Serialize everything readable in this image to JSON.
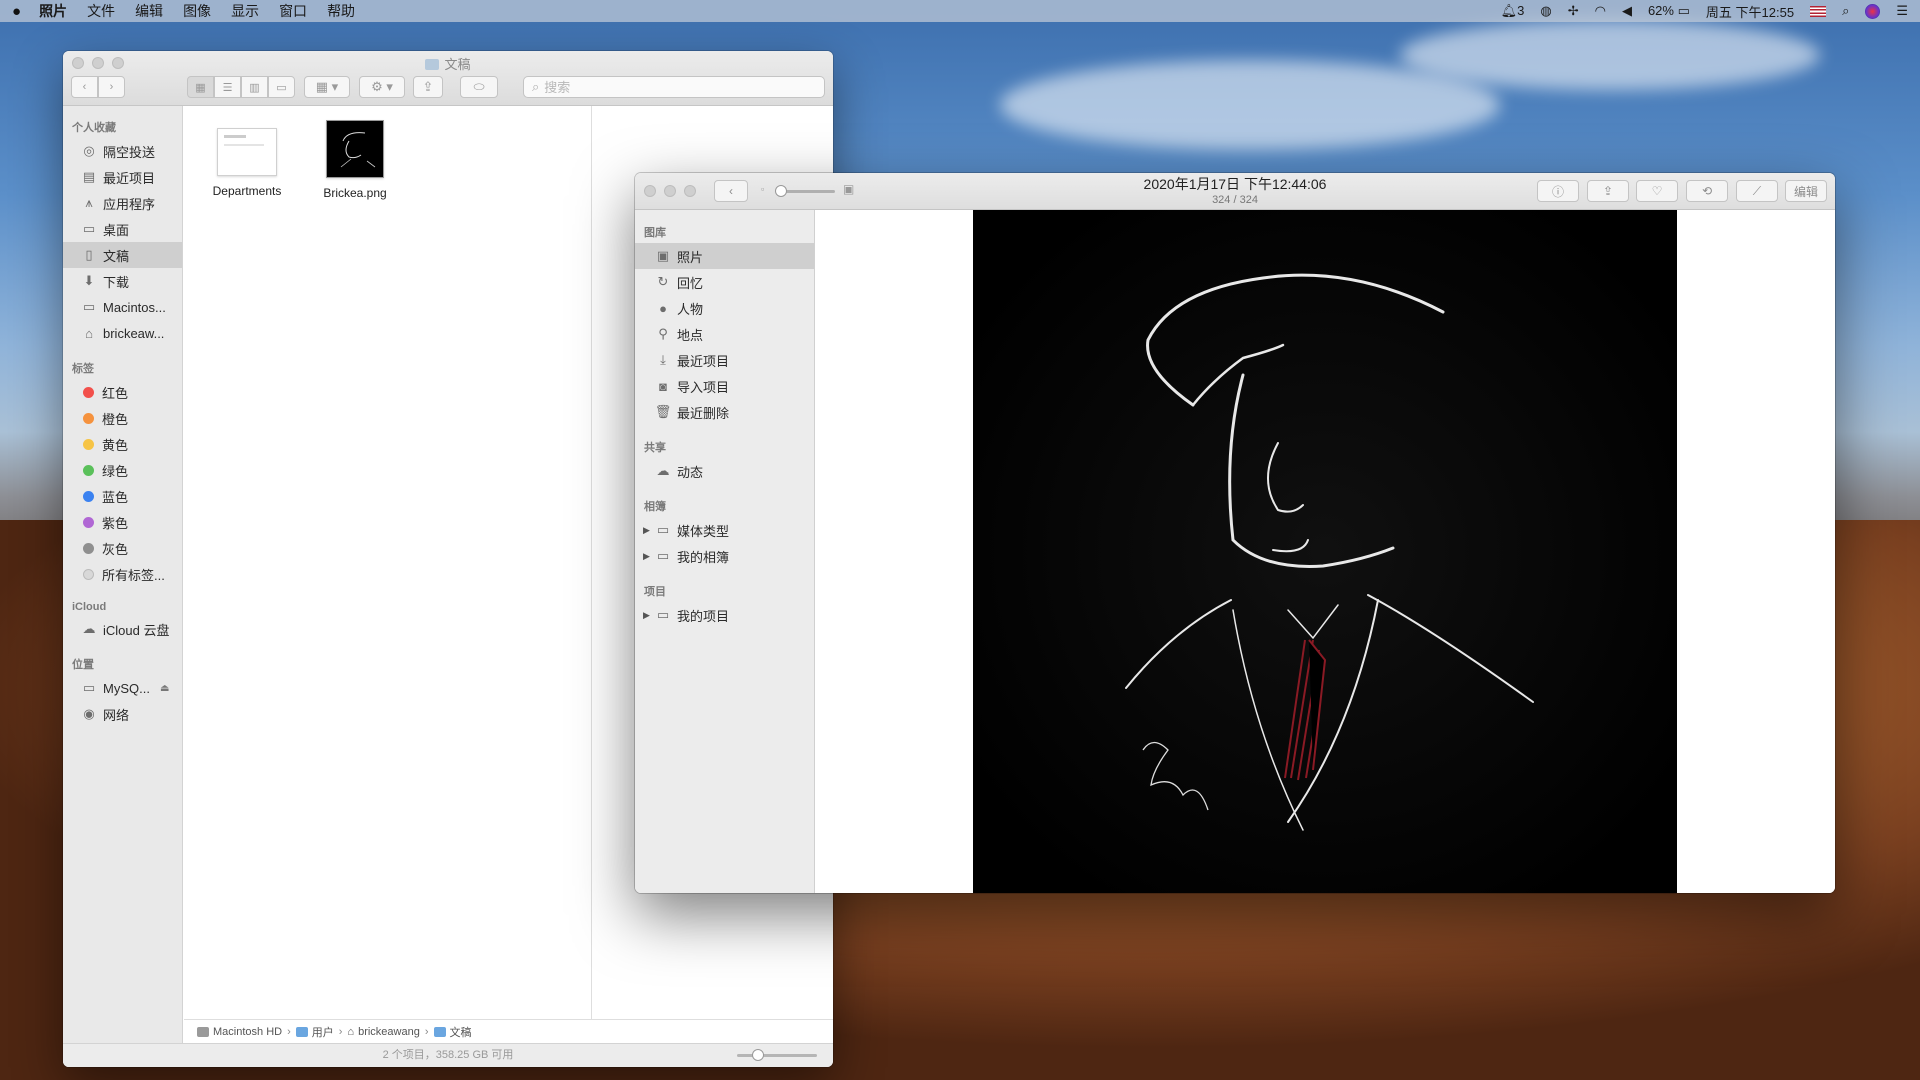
{
  "menubar": {
    "app_name": "照片",
    "menus": [
      "文件",
      "编辑",
      "图像",
      "显示",
      "窗口",
      "帮助"
    ],
    "notification_count": "3",
    "battery": "62%",
    "clock": "周五 下午12:55"
  },
  "finder": {
    "title": "文稿",
    "search_placeholder": "搜索",
    "sections": {
      "favorites": "个人收藏",
      "tags": "标签",
      "icloud": "iCloud",
      "locations": "位置"
    },
    "favorites": [
      {
        "label": "隔空投送",
        "icon": "airdrop-icon"
      },
      {
        "label": "最近项目",
        "icon": "recents-icon"
      },
      {
        "label": "应用程序",
        "icon": "applications-icon"
      },
      {
        "label": "桌面",
        "icon": "desktop-icon"
      },
      {
        "label": "文稿",
        "icon": "documents-icon"
      },
      {
        "label": "下载",
        "icon": "downloads-icon"
      },
      {
        "label": "Macintos...",
        "icon": "disk-icon"
      },
      {
        "label": "brickeaw...",
        "icon": "home-icon"
      }
    ],
    "tags": [
      {
        "label": "红色",
        "color": "#f2504b"
      },
      {
        "label": "橙色",
        "color": "#f5923e"
      },
      {
        "label": "黄色",
        "color": "#f6c445"
      },
      {
        "label": "绿色",
        "color": "#5ac05a"
      },
      {
        "label": "蓝色",
        "color": "#3b82f0"
      },
      {
        "label": "紫色",
        "color": "#b067d4"
      },
      {
        "label": "灰色",
        "color": "#8f8f8f"
      },
      {
        "label": "所有标签...",
        "color": "#d8d8d8"
      }
    ],
    "icloud_items": [
      {
        "label": "iCloud 云盘",
        "icon": "cloud-icon"
      }
    ],
    "locations": [
      {
        "label": "MySQ...",
        "icon": "disk-icon"
      },
      {
        "label": "网络",
        "icon": "network-icon"
      }
    ],
    "files": [
      {
        "name": "Departments"
      },
      {
        "name": "Brickea.png"
      }
    ],
    "path": [
      "Macintosh HD",
      "用户",
      "brickeawang",
      "文稿"
    ],
    "status": "2 个项目，358.25 GB 可用"
  },
  "photos": {
    "title": "2020年1月17日 下午12:44:06",
    "subtitle": "324 / 324",
    "edit_label": "编辑",
    "sections": {
      "library": "图库",
      "shared": "共享",
      "albums": "相簿",
      "projects": "项目"
    },
    "library": [
      {
        "label": "照片",
        "icon": "photos-icon"
      },
      {
        "label": "回忆",
        "icon": "memories-icon"
      },
      {
        "label": "人物",
        "icon": "people-icon"
      },
      {
        "label": "地点",
        "icon": "places-icon"
      },
      {
        "label": "最近项目",
        "icon": "recent-import-icon"
      },
      {
        "label": "导入项目",
        "icon": "import-icon"
      },
      {
        "label": "最近删除",
        "icon": "trash-icon"
      }
    ],
    "shared": [
      {
        "label": "动态",
        "icon": "cloud-icon"
      }
    ],
    "albums": [
      {
        "label": "媒体类型",
        "icon": "folder-icon"
      },
      {
        "label": "我的相簿",
        "icon": "folder-icon"
      }
    ],
    "projects": [
      {
        "label": "我的项目",
        "icon": "folder-icon"
      }
    ]
  }
}
